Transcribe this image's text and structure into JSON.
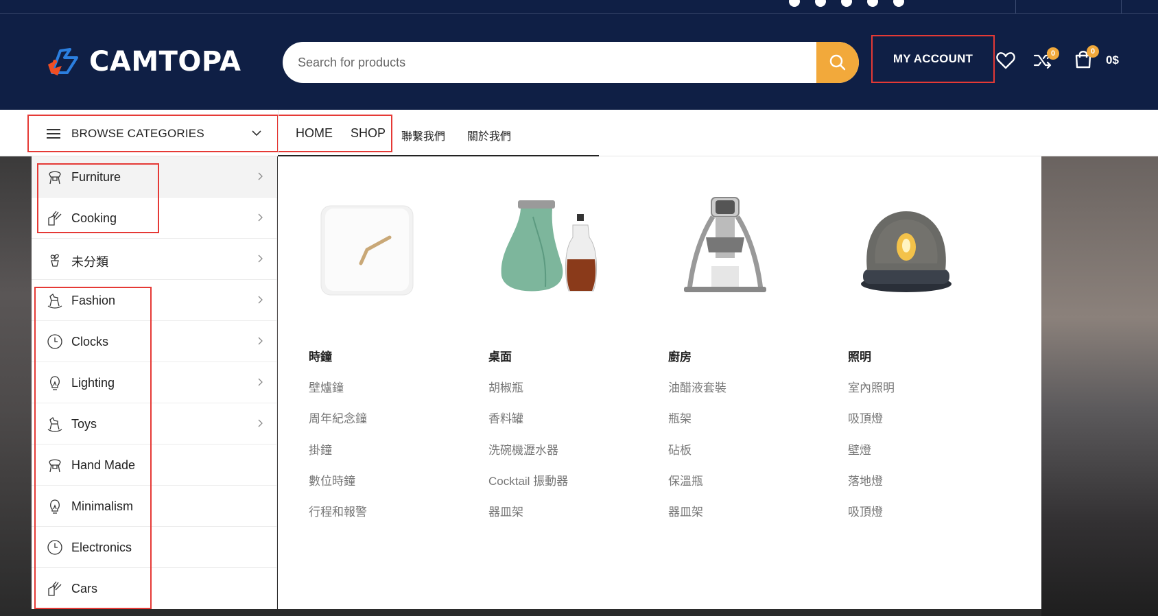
{
  "header": {
    "logo_text": "CAMTOPA",
    "search_placeholder": "Search for products",
    "my_account": "MY ACCOUNT",
    "compare_count": "0",
    "cart_count": "0",
    "cart_total": "0$"
  },
  "nav": {
    "browse_label": "BROWSE CATEGORIES",
    "links": [
      "HOME",
      "SHOP",
      "聯繫我們",
      "關於我們"
    ]
  },
  "sidebar": {
    "items": [
      {
        "label": "Furniture",
        "icon": "chair-icon",
        "has_sub": true
      },
      {
        "label": "Cooking",
        "icon": "knife-block-icon",
        "has_sub": true
      },
      {
        "label": "未分類",
        "icon": "plant-icon",
        "has_sub": true
      },
      {
        "label": "Fashion",
        "icon": "rocking-horse-icon",
        "has_sub": true
      },
      {
        "label": "Clocks",
        "icon": "clock-icon",
        "has_sub": true
      },
      {
        "label": "Lighting",
        "icon": "bulb-icon",
        "has_sub": true
      },
      {
        "label": "Toys",
        "icon": "rocking-horse-icon",
        "has_sub": true
      },
      {
        "label": "Hand Made",
        "icon": "chair-icon",
        "has_sub": false
      },
      {
        "label": "Minimalism",
        "icon": "bulb-icon",
        "has_sub": false
      },
      {
        "label": "Electronics",
        "icon": "clock-icon",
        "has_sub": false
      },
      {
        "label": "Cars",
        "icon": "knife-block-icon",
        "has_sub": false
      }
    ]
  },
  "mega": {
    "columns": [
      {
        "title": "時鐘",
        "links": [
          "壁爐鐘",
          "周年紀念鐘",
          "掛鐘",
          "數位時鐘",
          "行程和報警"
        ],
        "image": "clock-image"
      },
      {
        "title": "桌面",
        "links": [
          "胡椒瓶",
          "香料罐",
          "洗碗機瀝水器",
          "Cocktail 振動器",
          "器皿架"
        ],
        "image": "carafe-image"
      },
      {
        "title": "廚房",
        "links": [
          "油醋液套裝",
          "瓶架",
          "砧板",
          "保溫瓶",
          "器皿架"
        ],
        "image": "espresso-maker-image"
      },
      {
        "title": "照明",
        "links": [
          "室內照明",
          "吸頂燈",
          "壁燈",
          "落地燈",
          "吸頂燈"
        ],
        "image": "lamp-image"
      }
    ]
  },
  "colors": {
    "header_bg": "#0f1f45",
    "accent": "#f2a93b",
    "highlight_border": "#e53935"
  }
}
